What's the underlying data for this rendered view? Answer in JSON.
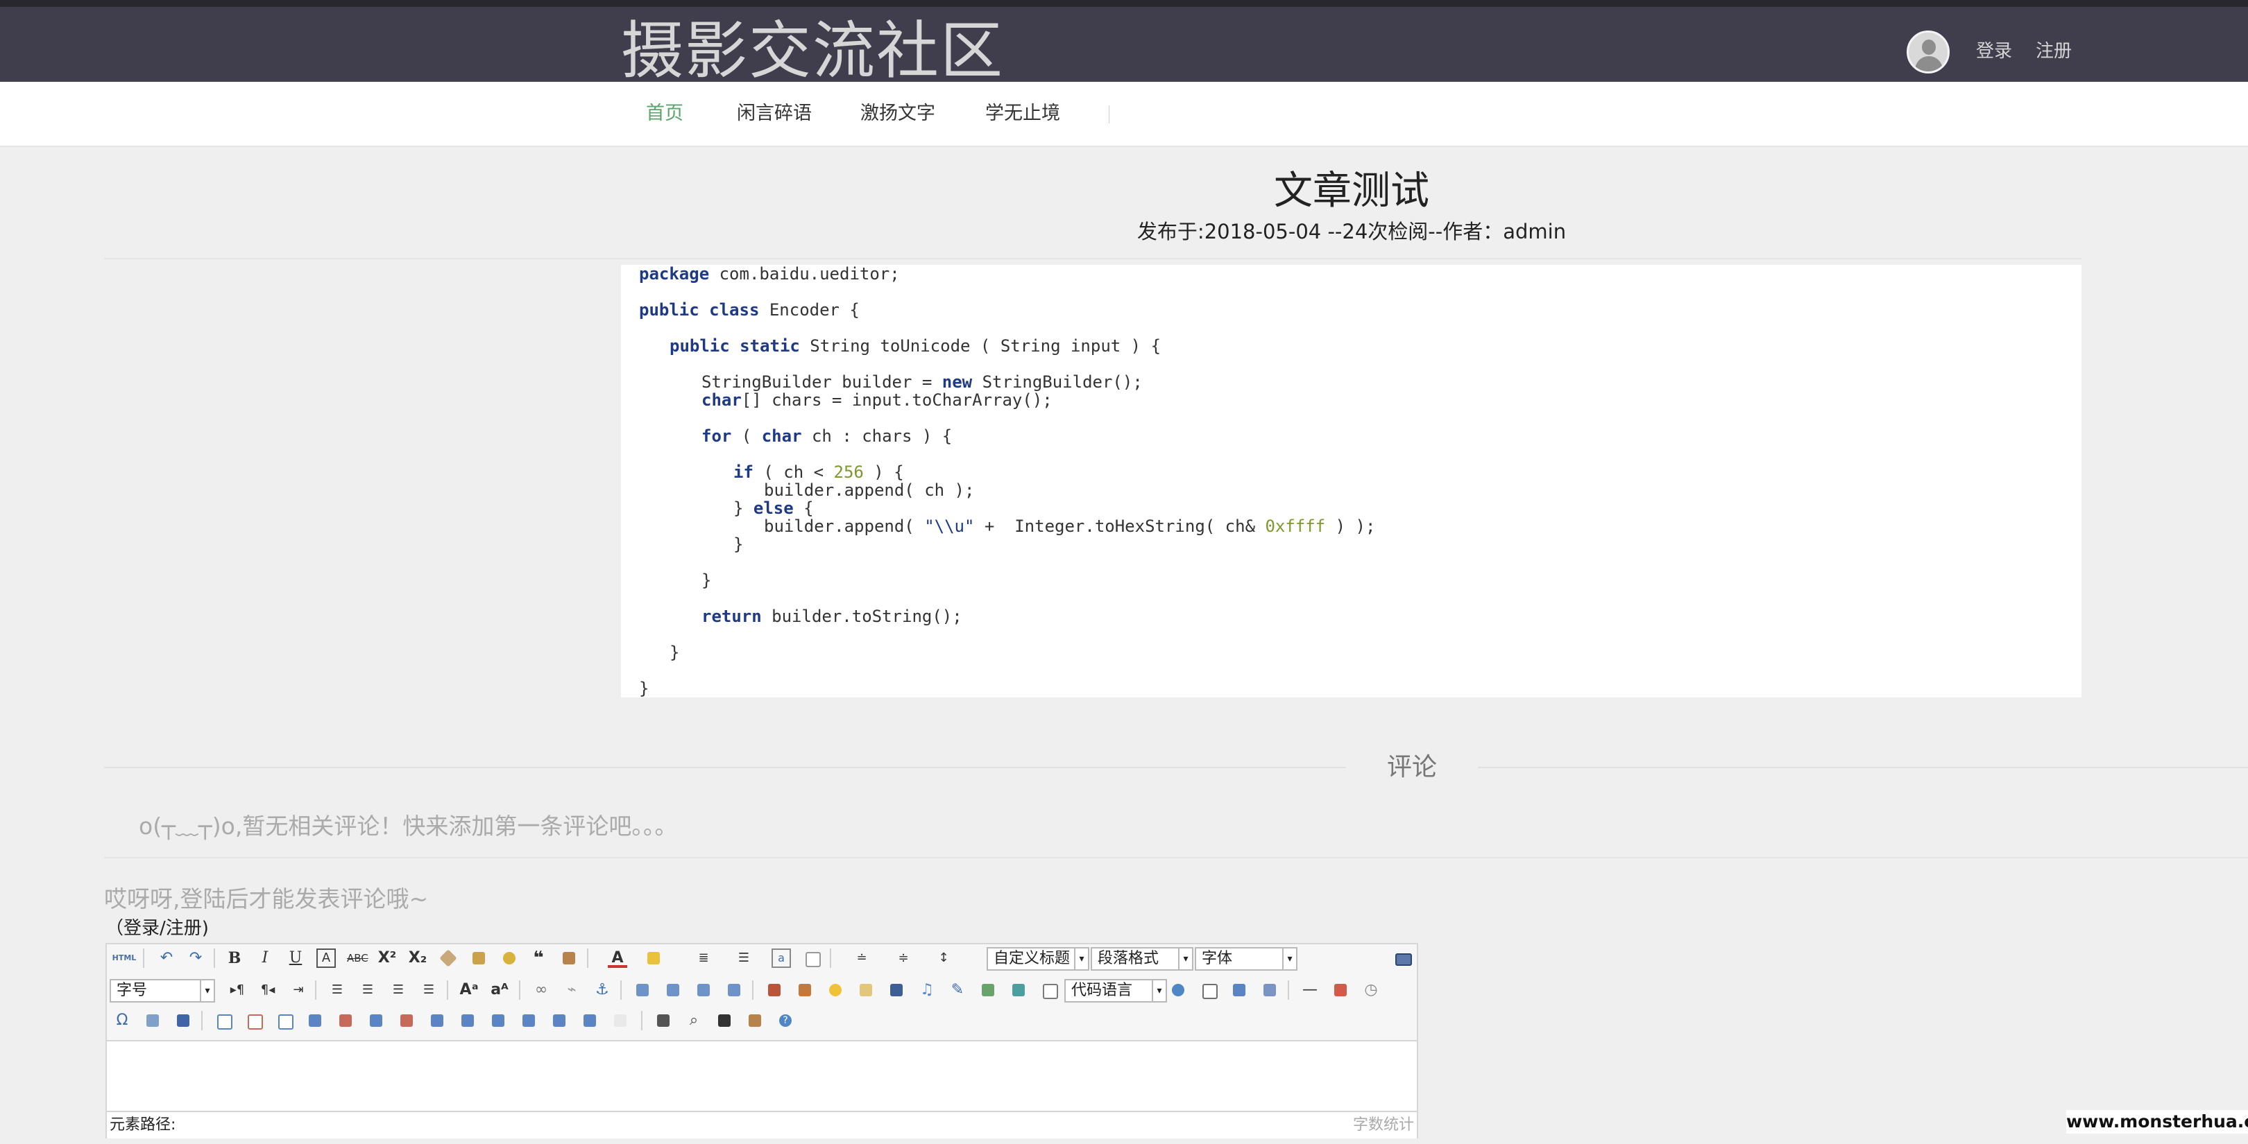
{
  "header": {
    "site_title": "摄影交流社区",
    "login_label": "登录",
    "register_label": "注册"
  },
  "nav": {
    "items": [
      {
        "label": "首页",
        "active": true
      },
      {
        "label": "闲言碎语"
      },
      {
        "label": "激扬文字"
      },
      {
        "label": "学无止境"
      }
    ]
  },
  "article": {
    "title": "文章测试",
    "meta": "发布于:2018-05-04 --24次检阅--作者：admin",
    "code_lines": [
      "package com.baidu.ueditor;",
      "public class Encoder {",
      "public static String toUnicode ( String input ) {",
      "StringBuilder builder = new StringBuilder();",
      "char[] chars = input.toCharArray();",
      "for ( char ch : chars ) {",
      "if ( ch < 256 ) {",
      "builder.append( ch );",
      "} else {",
      "builder.append( \"\\\\u\" +  Integer.toHexString( ch& 0xffff ) );",
      "}",
      "}",
      "return builder.toString();",
      "}",
      "}"
    ]
  },
  "comments": {
    "heading": "评论",
    "empty_text": "o(┬﹏┬)o,暂无相关评论！快来添加第一条评论吧。。。",
    "login_hint": "哎呀呀,登陆后才能发表评论哦~",
    "login_link": "（登录/注册)"
  },
  "editor": {
    "selects": {
      "custom_heading": "自定义标题",
      "paragraph_format": "段落格式",
      "font_family": "字体",
      "font_size": "字号",
      "code_language": "代码语言"
    },
    "html_label": "HTML",
    "path_label": "元素路径:",
    "word_count_label": "字数统计",
    "buttons_row1": [
      "html-source",
      "undo",
      "redo",
      "bold",
      "italic",
      "underline",
      "fontborder",
      "strikethrough",
      "superscript",
      "subscript",
      "removeformat",
      "formatmatch",
      "autotypeset",
      "blockquote",
      "pasteplain",
      "forecolor",
      "backcolor",
      "insertorderedlist",
      "insertunorderedlist",
      "selectall",
      "cleardoc",
      "rowspacingtop",
      "rowspacingbottom",
      "lineheight"
    ],
    "buttons_row2": [
      "directionalityltr",
      "directionalityrtl",
      "indent",
      "justifyleft",
      "justifycenter",
      "justifyright",
      "justifyjustify",
      "touppercase",
      "tolowercase",
      "link",
      "unlink",
      "anchor",
      "imagenone",
      "imageleft",
      "imageright",
      "imagecenter",
      "simpleupload",
      "insertimage",
      "emotion",
      "scrawl",
      "insertvideo",
      "music",
      "attachment",
      "map",
      "gmap",
      "insertframe",
      "insertcode",
      "webapp",
      "pagebreak",
      "template",
      "background",
      "horizontal",
      "date",
      "time"
    ],
    "buttons_row3": [
      "spechars",
      "snapscreen",
      "wordimage",
      "inserttable",
      "deletetable",
      "insertparagraphbeforetable",
      "insertrow",
      "deleterow",
      "insertcol",
      "deletecol",
      "mergecells",
      "mergeright",
      "mergedown",
      "splittocells",
      "splittorows",
      "splittocols",
      "charts",
      "print",
      "preview",
      "searchreplace",
      "drafts",
      "help"
    ]
  },
  "watermark": "www.monsterhua.com",
  "colors": {
    "header_bg": "#403e4c",
    "nav_active": "#5aa36a",
    "keyword": "#1f3a84",
    "number": "#7c9a2b"
  }
}
